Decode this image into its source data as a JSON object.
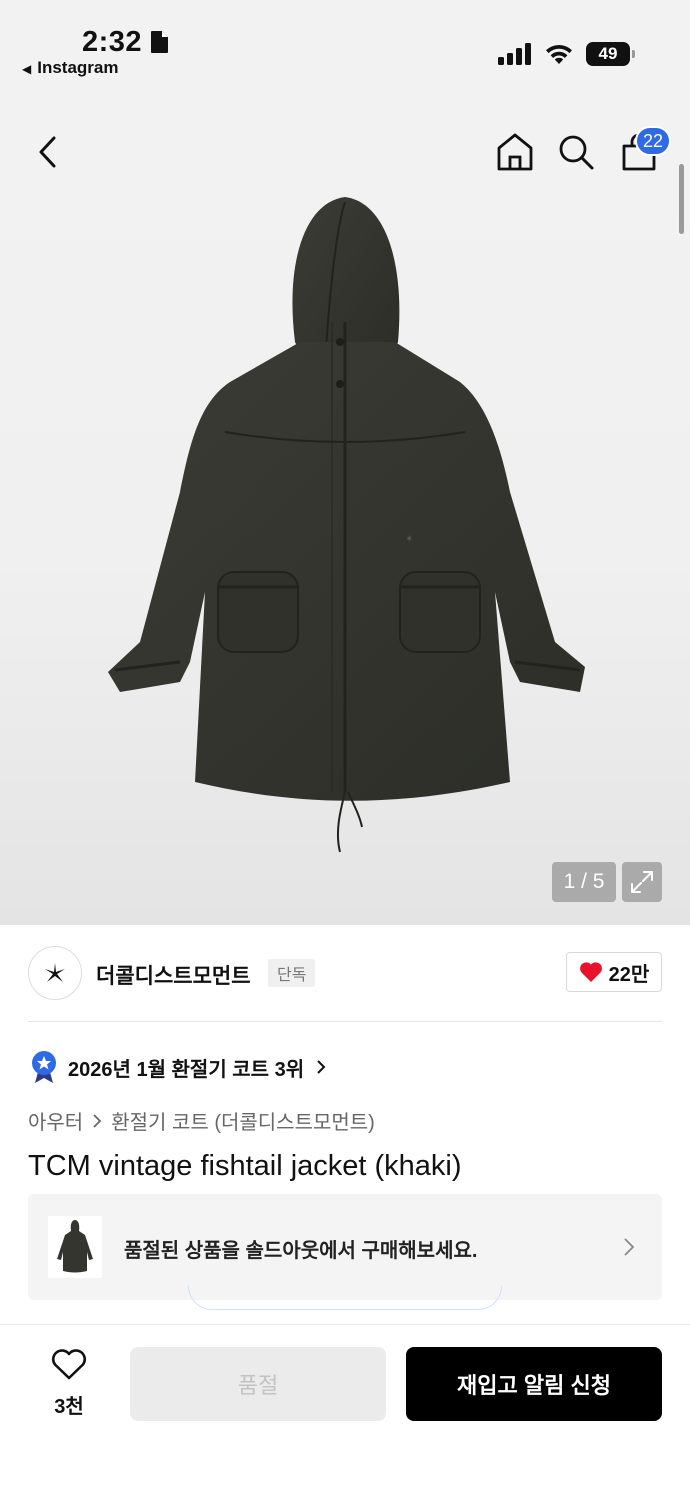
{
  "status_bar": {
    "time": "2:32",
    "back_app": "Instagram",
    "battery": "49",
    "icons": [
      "signal-icon",
      "wifi-icon",
      "battery-icon",
      "document-icon"
    ]
  },
  "header": {
    "icons": [
      "back-icon",
      "home-icon",
      "search-icon",
      "cart-icon"
    ],
    "cart_count": "22"
  },
  "gallery": {
    "counter": "1 / 5",
    "expand_icon": "expand-icon"
  },
  "brand": {
    "name": "더콜디스트모먼트",
    "badge": "단독",
    "likes": "22만"
  },
  "ranking": {
    "text": "2026년 1월 환절기 코트 3위"
  },
  "breadcrumb": {
    "category": "아우터",
    "subcategory": "환절기 코트 (더콜디스트모먼트)"
  },
  "product": {
    "title": "TCM vintage fishtail jacket (khaki)"
  },
  "soldout_banner": {
    "text": "품절된 상품을 솔드아웃에서 구매해보세요."
  },
  "bottom_bar": {
    "wish_count": "3천",
    "soldout_label": "품절",
    "restock_label": "재입고 알림 신청"
  },
  "colors": {
    "accent_blue": "#2f6ae6",
    "heart_red": "#e8132b",
    "jacket": "#34352e"
  }
}
